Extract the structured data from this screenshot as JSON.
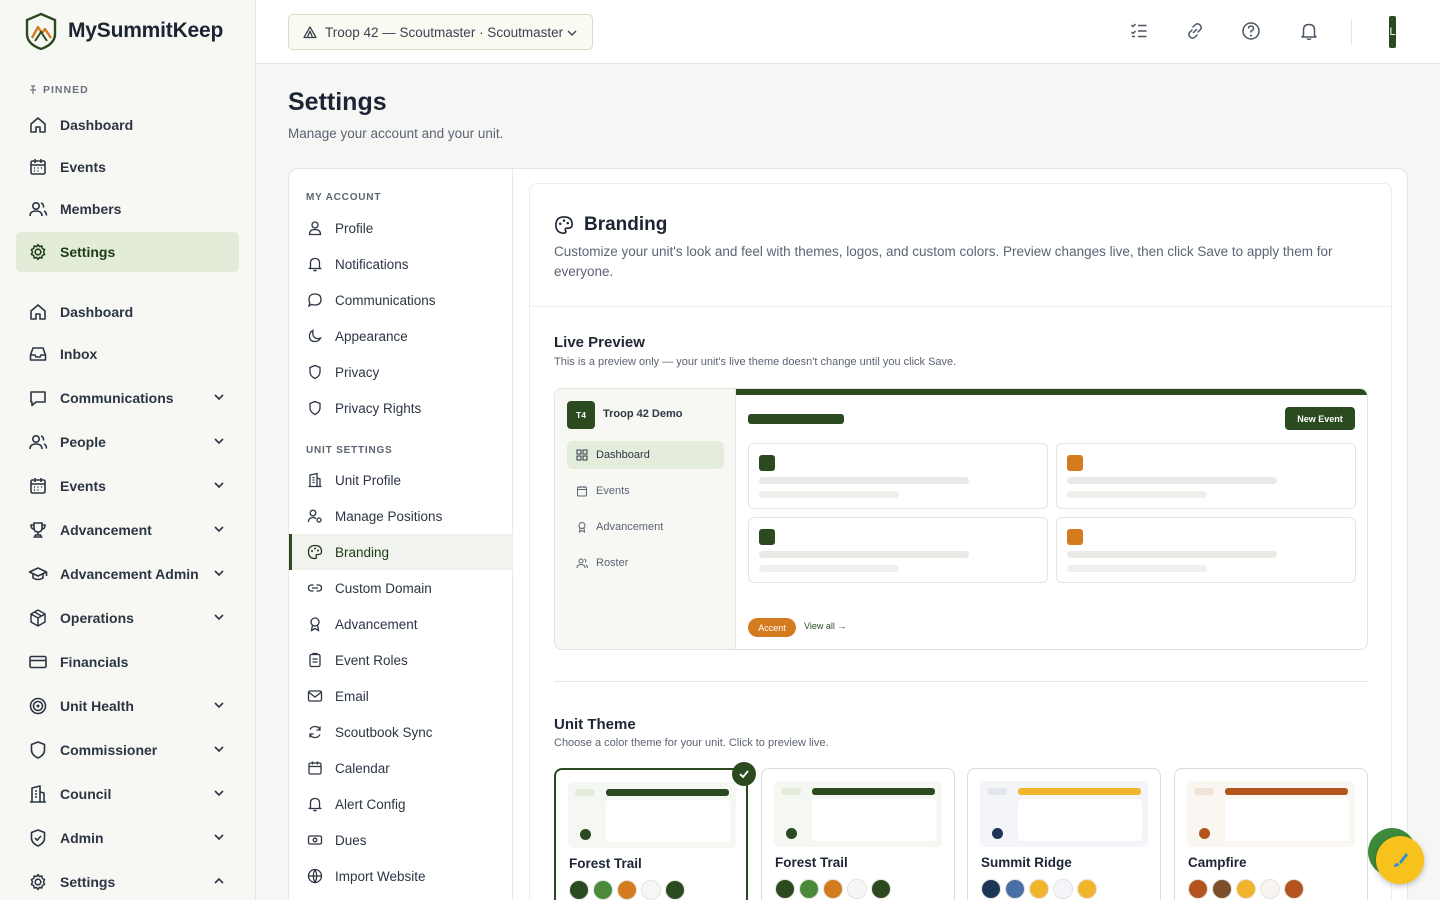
{
  "app": {
    "name": "MySummitKeep"
  },
  "sidebar": {
    "pinned_label": "PINNED",
    "pinned": [
      {
        "label": "Dashboard",
        "icon": "home-icon"
      },
      {
        "label": "Events",
        "icon": "calendar-icon"
      },
      {
        "label": "Members",
        "icon": "users-icon"
      },
      {
        "label": "Settings",
        "icon": "gear-icon",
        "active": true
      }
    ],
    "items": [
      {
        "label": "Dashboard",
        "icon": "home-icon"
      },
      {
        "label": "Inbox",
        "icon": "inbox-icon"
      },
      {
        "label": "Communications",
        "icon": "chat-icon",
        "expandable": true
      },
      {
        "label": "People",
        "icon": "users-icon",
        "expandable": true
      },
      {
        "label": "Events",
        "icon": "calendar-icon",
        "expandable": true
      },
      {
        "label": "Advancement",
        "icon": "trophy-icon",
        "expandable": true
      },
      {
        "label": "Advancement Admin",
        "icon": "graduation-cap-icon",
        "expandable": true
      },
      {
        "label": "Operations",
        "icon": "box-icon",
        "expandable": true
      },
      {
        "label": "Financials",
        "icon": "credit-card-icon"
      },
      {
        "label": "Unit Health",
        "icon": "target-icon",
        "expandable": true
      },
      {
        "label": "Commissioner",
        "icon": "shield-icon",
        "expandable": true
      },
      {
        "label": "Council",
        "icon": "building-icon",
        "expandable": true
      },
      {
        "label": "Admin",
        "icon": "shield-check-icon",
        "expandable": true
      },
      {
        "label": "Settings",
        "icon": "gear-icon",
        "expandable": true,
        "expanded": true
      }
    ]
  },
  "topbar": {
    "unit_selector": "Troop 42 — Scoutmaster · Scoutmaster",
    "icons": [
      "checklist-icon",
      "link-icon",
      "help-icon",
      "bell-icon"
    ]
  },
  "page": {
    "title": "Settings",
    "subtitle": "Manage your account and your unit."
  },
  "settings_nav": {
    "account_label": "MY ACCOUNT",
    "account_items": [
      {
        "label": "Profile",
        "icon": "user-icon"
      },
      {
        "label": "Notifications",
        "icon": "bell-icon"
      },
      {
        "label": "Communications",
        "icon": "chat-bubble-icon"
      },
      {
        "label": "Appearance",
        "icon": "moon-icon"
      },
      {
        "label": "Privacy",
        "icon": "shield-icon"
      },
      {
        "label": "Privacy Rights",
        "icon": "shield-icon"
      }
    ],
    "unit_label": "UNIT SETTINGS",
    "unit_items": [
      {
        "label": "Unit Profile",
        "icon": "building-icon"
      },
      {
        "label": "Manage Positions",
        "icon": "user-cog-icon"
      },
      {
        "label": "Branding",
        "icon": "palette-icon",
        "active": true
      },
      {
        "label": "Custom Domain",
        "icon": "link-icon"
      },
      {
        "label": "Advancement",
        "icon": "award-icon"
      },
      {
        "label": "Event Roles",
        "icon": "clipboard-icon"
      },
      {
        "label": "Email",
        "icon": "mail-icon"
      },
      {
        "label": "Scoutbook Sync",
        "icon": "refresh-icon"
      },
      {
        "label": "Calendar",
        "icon": "calendar-icon"
      },
      {
        "label": "Alert Config",
        "icon": "bell-icon"
      },
      {
        "label": "Dues",
        "icon": "banknote-icon"
      },
      {
        "label": "Import Website",
        "icon": "globe-icon"
      }
    ]
  },
  "branding": {
    "title": "Branding",
    "description": "Customize your unit's look and feel with themes, logos, and custom colors. Preview changes live, then click Save to apply them for everyone.",
    "live_preview": {
      "title": "Live Preview",
      "subtitle": "This is a preview only — your unit's live theme doesn't change until you click Save.",
      "badge": "T4",
      "unit_name": "Troop 42 Demo",
      "nav": [
        {
          "label": "Dashboard",
          "icon": "grid-icon",
          "active": true
        },
        {
          "label": "Events",
          "icon": "calendar-icon"
        },
        {
          "label": "Advancement",
          "icon": "award-icon"
        },
        {
          "label": "Roster",
          "icon": "users-icon"
        }
      ],
      "new_event_label": "New Event",
      "accent_label": "Accent",
      "view_all_label": "View all →",
      "card_colors": [
        "#2b4a20",
        "#d47a1f",
        "#2b4a20",
        "#d47a1f"
      ]
    },
    "unit_theme": {
      "title": "Unit Theme",
      "subtitle": "Choose a color theme for your unit. Click to preview live.",
      "themes": [
        {
          "name": "Forest Trail",
          "selected": true,
          "bar": "#2b4a20",
          "pill": "#e4ecdc",
          "bg": "#f5f7f2",
          "swatches": [
            "#2b4a20",
            "#4a8a3a",
            "#d47a1f",
            "#f6f6f4",
            "#2b4a20"
          ]
        },
        {
          "name": "Forest Trail",
          "selected": false,
          "bar": "#2b4a20",
          "pill": "#e4ecdc",
          "bg": "#f5f7f2",
          "swatches": [
            "#2b4a20",
            "#4a8a3a",
            "#d47a1f",
            "#f6f6f4",
            "#2b4a20"
          ]
        },
        {
          "name": "Summit Ridge",
          "selected": false,
          "bar": "#f0b52c",
          "pill": "#e2e6ee",
          "bg": "#f4f5f8",
          "swatches": [
            "#1f3557",
            "#4a6fa5",
            "#f0b52c",
            "#f4f5f8",
            "#f0b52c"
          ]
        },
        {
          "name": "Campfire",
          "selected": false,
          "bar": "#b3541e",
          "pill": "#f3e2d6",
          "bg": "#faf6f2",
          "swatches": [
            "#b3541e",
            "#7a4f2a",
            "#f0b52c",
            "#f8f4ef",
            "#b3541e"
          ]
        }
      ]
    }
  },
  "colors": {
    "primary": "#2b4a20",
    "accent": "#d47a1f",
    "fab": "#f7c21c"
  }
}
